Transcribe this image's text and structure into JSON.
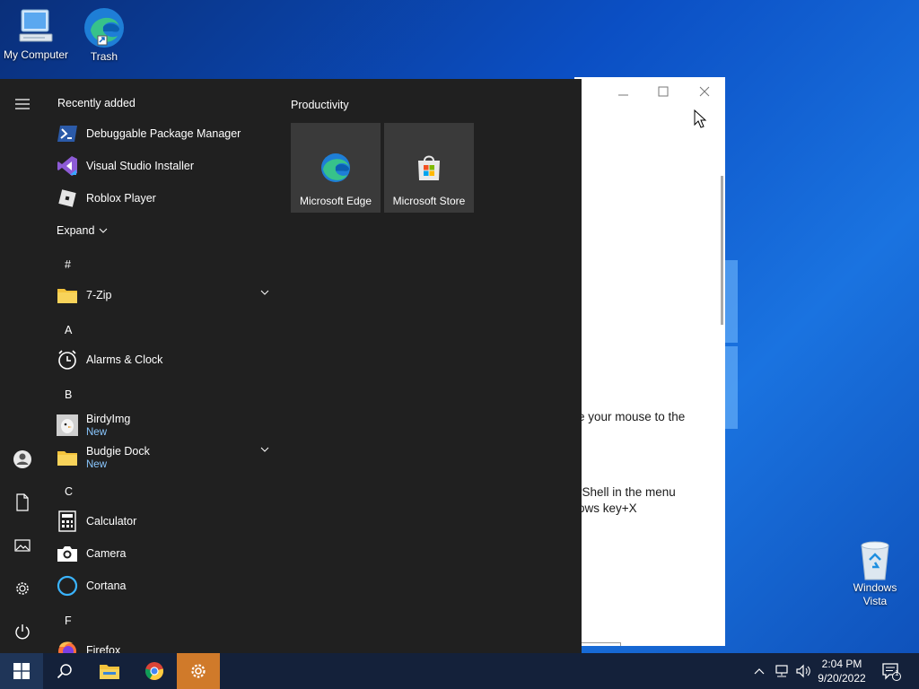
{
  "desktop": {
    "icons": [
      {
        "label": "My Computer",
        "icon": "computer-icon"
      },
      {
        "label": "Trash",
        "icon": "edge-icon"
      },
      {
        "label": "Windows\nVista",
        "icon": "recycle-bin-icon"
      }
    ]
  },
  "background_window": {
    "text_lines": [
      "e your mouse to the",
      "rShell in the menu",
      "ows key+X"
    ]
  },
  "start_menu": {
    "recently_added_header": "Recently added",
    "recent_apps": [
      {
        "label": "Debuggable Package Manager",
        "icon": "powershell-icon"
      },
      {
        "label": "Visual Studio Installer",
        "icon": "visual-studio-icon"
      },
      {
        "label": "Roblox Player",
        "icon": "roblox-icon"
      }
    ],
    "expand_label": "Expand",
    "groups": [
      {
        "letter": "#",
        "apps": [
          {
            "label": "7-Zip",
            "icon": "folder-icon",
            "expandable": true
          }
        ]
      },
      {
        "letter": "A",
        "apps": [
          {
            "label": "Alarms & Clock",
            "icon": "alarm-clock-icon"
          }
        ]
      },
      {
        "letter": "B",
        "apps": [
          {
            "label": "BirdyImg",
            "sub": "New",
            "icon": "birdyimg-icon"
          },
          {
            "label": "Budgie Dock",
            "sub": "New",
            "icon": "folder-icon",
            "expandable": true
          }
        ]
      },
      {
        "letter": "C",
        "apps": [
          {
            "label": "Calculator",
            "icon": "calculator-icon"
          },
          {
            "label": "Camera",
            "icon": "camera-icon"
          },
          {
            "label": "Cortana",
            "icon": "cortana-icon"
          }
        ]
      },
      {
        "letter": "F",
        "apps": [
          {
            "label": "Firefox",
            "icon": "firefox-icon"
          }
        ]
      }
    ],
    "tiles_header": "Productivity",
    "tiles": [
      {
        "label": "Microsoft Edge",
        "icon": "edge-icon"
      },
      {
        "label": "Microsoft Store",
        "icon": "store-icon"
      }
    ],
    "rail": [
      "hamburger-menu-icon",
      "user-account-icon",
      "documents-icon",
      "pictures-icon",
      "settings-gear-icon",
      "power-icon"
    ]
  },
  "taskbar": {
    "buttons": [
      "windows-start-icon",
      "search-icon",
      "file-explorer-icon",
      "chrome-icon",
      "settings-gear-icon"
    ],
    "active": "settings-gear-icon",
    "tray": [
      "chevron-up-icon",
      "network-icon",
      "volume-icon"
    ],
    "clock_time": "2:04 PM",
    "clock_date": "9/20/2022",
    "notification_count": "1"
  },
  "colors": {
    "start_bg": "#202020",
    "tile_bg": "#3a3a3a",
    "taskbar_bg": "#14213a",
    "active_taskbar_button": "#d07a2a",
    "new_badge": "#8ac7ff"
  }
}
